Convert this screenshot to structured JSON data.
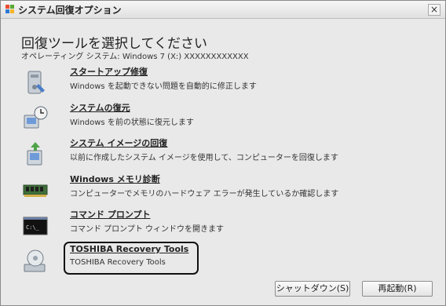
{
  "window": {
    "title": "システム回復オプション",
    "close_label": "×"
  },
  "heading": "回復ツールを選択してください",
  "os_line": "オペレーティング システム: Windows 7 (X:) XXXXXXXXXXXX",
  "items": [
    {
      "title": "スタートアップ修復",
      "description": "Windows を起動できない問題を自動的に修正します",
      "icon": "startup-repair-icon"
    },
    {
      "title": "システムの復元",
      "description": "Windows を前の状態に復元します",
      "icon": "system-restore-icon"
    },
    {
      "title": "システム イメージの回復",
      "description": "以前に作成したシステム イメージを使用して、コンピューターを回復します",
      "icon": "system-image-icon"
    },
    {
      "title": "Windows メモリ診断",
      "description": "コンピューターでメモリのハードウェア エラーが発生しているか確認します",
      "icon": "memory-icon"
    },
    {
      "title": "コマンド プロンプト",
      "description": "コマンド プロンプト ウィンドウを開きます",
      "icon": "command-prompt-icon"
    },
    {
      "title": "TOSHIBA Recovery Tools",
      "description": "TOSHIBA Recovery Tools",
      "icon": "toshiba-recovery-icon"
    }
  ],
  "buttons": {
    "shutdown": "シャットダウン(S)",
    "restart": "再起動(R)"
  }
}
